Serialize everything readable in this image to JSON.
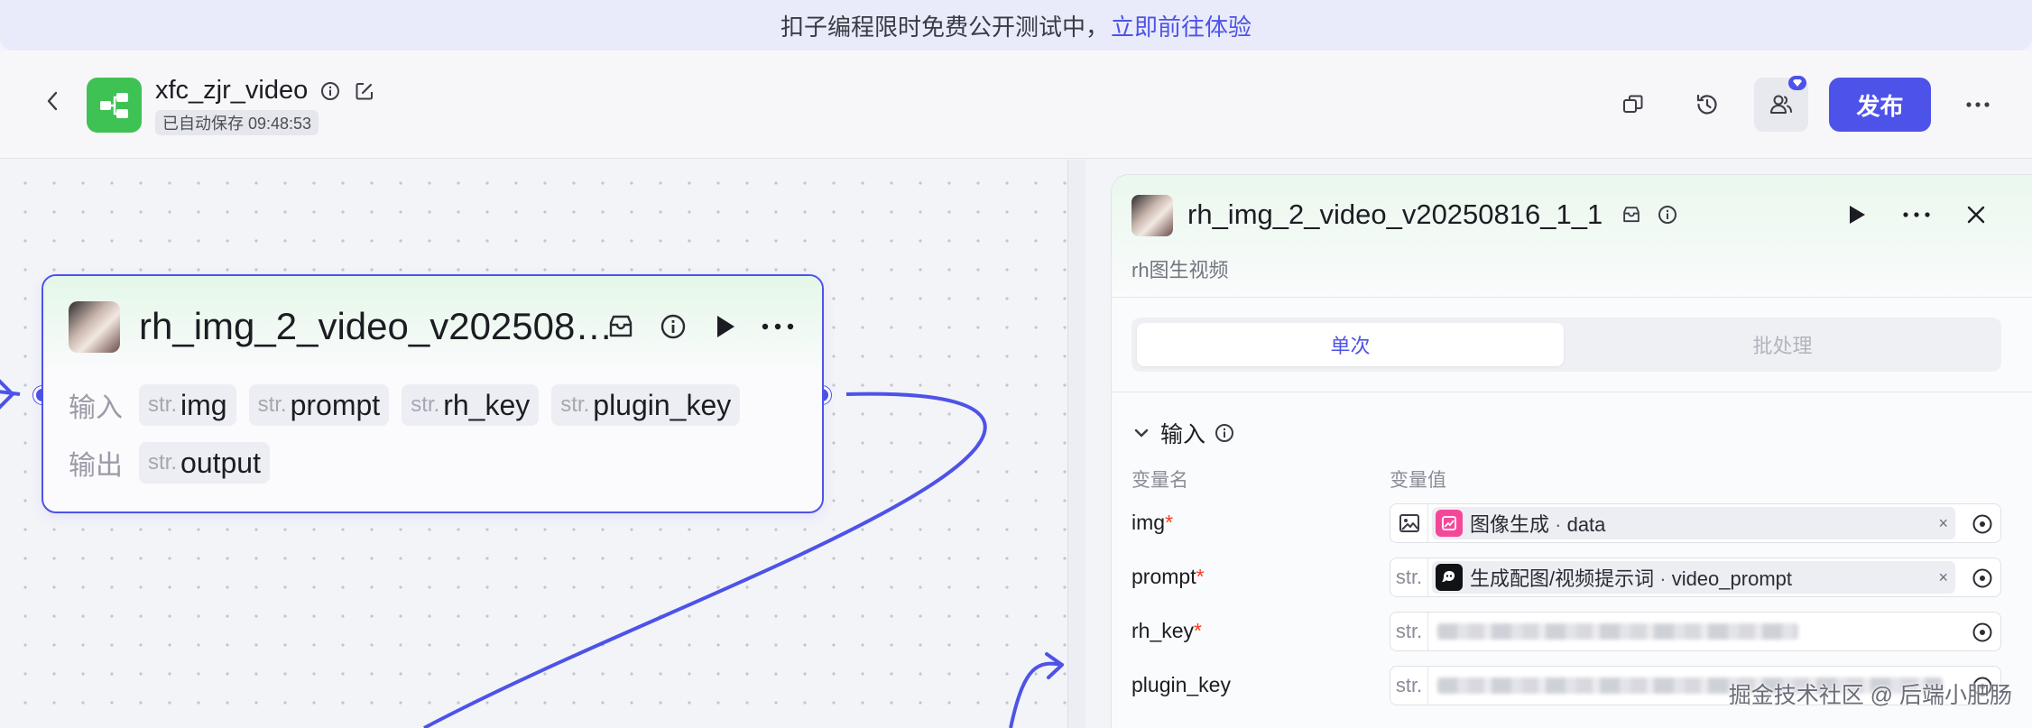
{
  "banner": {
    "text": "扣子编程限时免费公开测试中，",
    "link": "立即前往体验"
  },
  "header": {
    "app_name": "xfc_zjr_video",
    "autosave": "已自动保存 09:48:53",
    "publish_label": "发布"
  },
  "node": {
    "title": "rh_img_2_video_v20250816_1_1",
    "input_label": "输入",
    "output_label": "输出",
    "type_prefix": "str.",
    "inputs": [
      "img",
      "prompt",
      "rh_key",
      "plugin_key"
    ],
    "outputs": [
      "output"
    ]
  },
  "panel": {
    "title": "rh_img_2_video_v20250816_1_1",
    "description": "rh图生视频",
    "tabs": [
      {
        "label": "单次",
        "active": true
      },
      {
        "label": "批处理",
        "active": false
      }
    ],
    "section_title": "输入",
    "col_name": "变量名",
    "col_value": "变量值",
    "params": [
      {
        "name": "img",
        "required": true,
        "type": "image",
        "type_label": "",
        "ref_node": "图像生成",
        "ref_sep": " · ",
        "ref_field": "data",
        "ref_icon_color": "#f5479a"
      },
      {
        "name": "prompt",
        "required": true,
        "type": "str",
        "type_label": "str.",
        "ref_node": "生成配图/视频提示词",
        "ref_sep": " · ",
        "ref_field": "video_prompt",
        "ref_icon_color": "#111216"
      },
      {
        "name": "rh_key",
        "required": true,
        "type": "str",
        "type_label": "str.",
        "ref_node": "",
        "ref_field": ""
      },
      {
        "name": "plugin_key",
        "required": false,
        "type": "str",
        "type_label": "str.",
        "ref_node": "",
        "ref_field": ""
      }
    ],
    "required_mark": "*",
    "clear_mark": "×"
  },
  "watermark": "掘金技术社区 @ 后端小肥肠",
  "colors": {
    "accent": "#4d53e8",
    "app_icon": "#3ec254",
    "required": "#f93920"
  }
}
